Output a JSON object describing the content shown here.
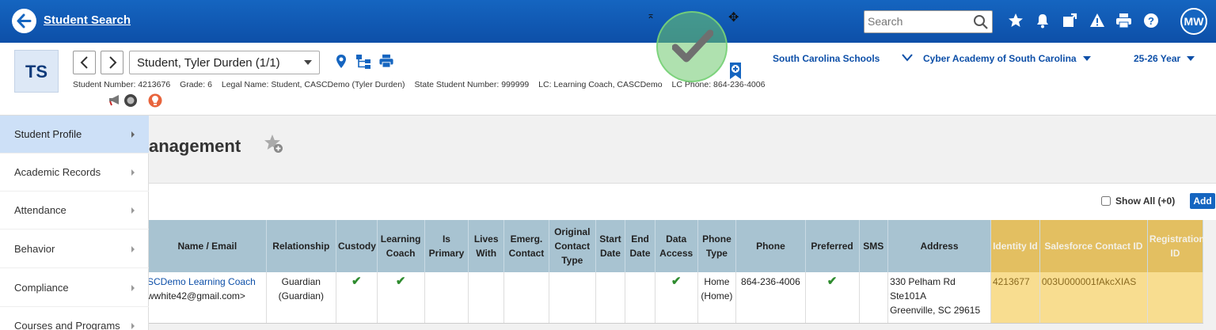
{
  "topbar": {
    "crumb": "Student Search",
    "search_placeholder": "Search",
    "user_initials": "MW"
  },
  "student": {
    "initials": "TS",
    "selector": "Student, Tyler Durden  (1/1)",
    "info": [
      "Student Number: 4213676",
      "Grade: 6",
      "Legal Name: Student, CASCDemo (Tyler Durden)",
      "State Student Number: 999999",
      "LC: Learning Coach, CASCDemo",
      "LC Phone: 864-236-4006"
    ]
  },
  "context": {
    "district": "South Carolina Schools",
    "school": "Cyber Academy of South Carolina",
    "year": "25-26 Year"
  },
  "sidebar": {
    "items": [
      {
        "label": "Student Profile"
      },
      {
        "label": "Academic Records"
      },
      {
        "label": "Attendance"
      },
      {
        "label": "Behavior"
      },
      {
        "label": "Compliance"
      },
      {
        "label": "Courses and Programs"
      }
    ]
  },
  "page": {
    "title": "anagement",
    "show_all": "Show All (+0)",
    "add": "Add"
  },
  "table": {
    "headers": [
      "Name / Email",
      "Relationship",
      "Custody",
      "Learning Coach",
      "Is Primary",
      "Lives With",
      "Emerg. Contact",
      "Original Contact Type",
      "Start Date",
      "End Date",
      "Data Access",
      "Phone Type",
      "Phone",
      "Preferred",
      "SMS",
      "Address",
      "Identity Id",
      "Salesforce Contact ID",
      "Registration ID"
    ],
    "row": {
      "name": "SCDemo Learning Coach",
      "email": "wwhite42@gmail.com>",
      "relationship": "Guardian (Guardian)",
      "custody": "✔",
      "learning_coach": "✔",
      "data_access": "✔",
      "phone_type": "Home (Home)",
      "phone": "864-236-4006",
      "preferred": "✔",
      "address_line1": "330 Pelham Rd",
      "address_line2": "Ste101A",
      "address_line3": "Greenville, SC 29615",
      "identity_id": "4213677",
      "salesforce_id": "003U000001fAkcXIAS"
    }
  },
  "colors": {
    "topbar": "#1565c0",
    "table_header": "#a8c3d1",
    "highlight": "#f8dd90",
    "sidebar_active": "#cde0f7"
  },
  "icons": [
    "back-arrow-icon",
    "search-icon",
    "star-icon",
    "bell-icon",
    "share-icon",
    "alert-icon",
    "print-icon",
    "help-icon",
    "location-pin-icon",
    "hierarchy-icon",
    "megaphone-icon",
    "badge-icon",
    "lightbulb-icon",
    "favorite-star-add-icon",
    "check-badge-icon"
  ]
}
